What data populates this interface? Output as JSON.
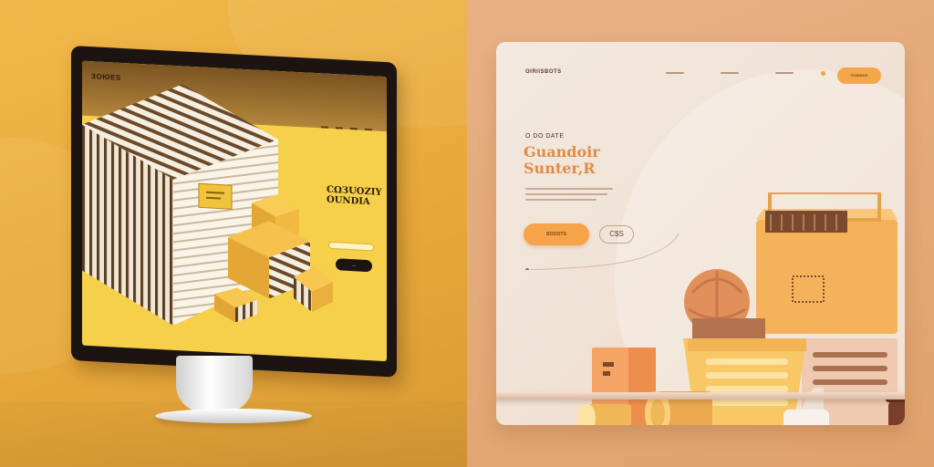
{
  "left_screen": {
    "logo": "ЗOЮES",
    "headline": "CΩЗUOZIY OUNDIA",
    "button_label": "—"
  },
  "right_card": {
    "logo": "OIRIISBOTS",
    "cta_label": "OOIDNOS",
    "eyebrow": "O DO DATE",
    "title": "Guandoir\nSunter,R",
    "primary_button": "BOOOTS",
    "secondary_button": "C$S"
  },
  "colors": {
    "left_background": "#e8a93a",
    "screen_yellow": "#f6d04a",
    "right_background": "#dfa26d",
    "accent_orange": "#f6a34a",
    "title_orange": "#e08c45"
  },
  "icons": [
    "stripe-box-illustration",
    "product-shelf-illustration"
  ]
}
